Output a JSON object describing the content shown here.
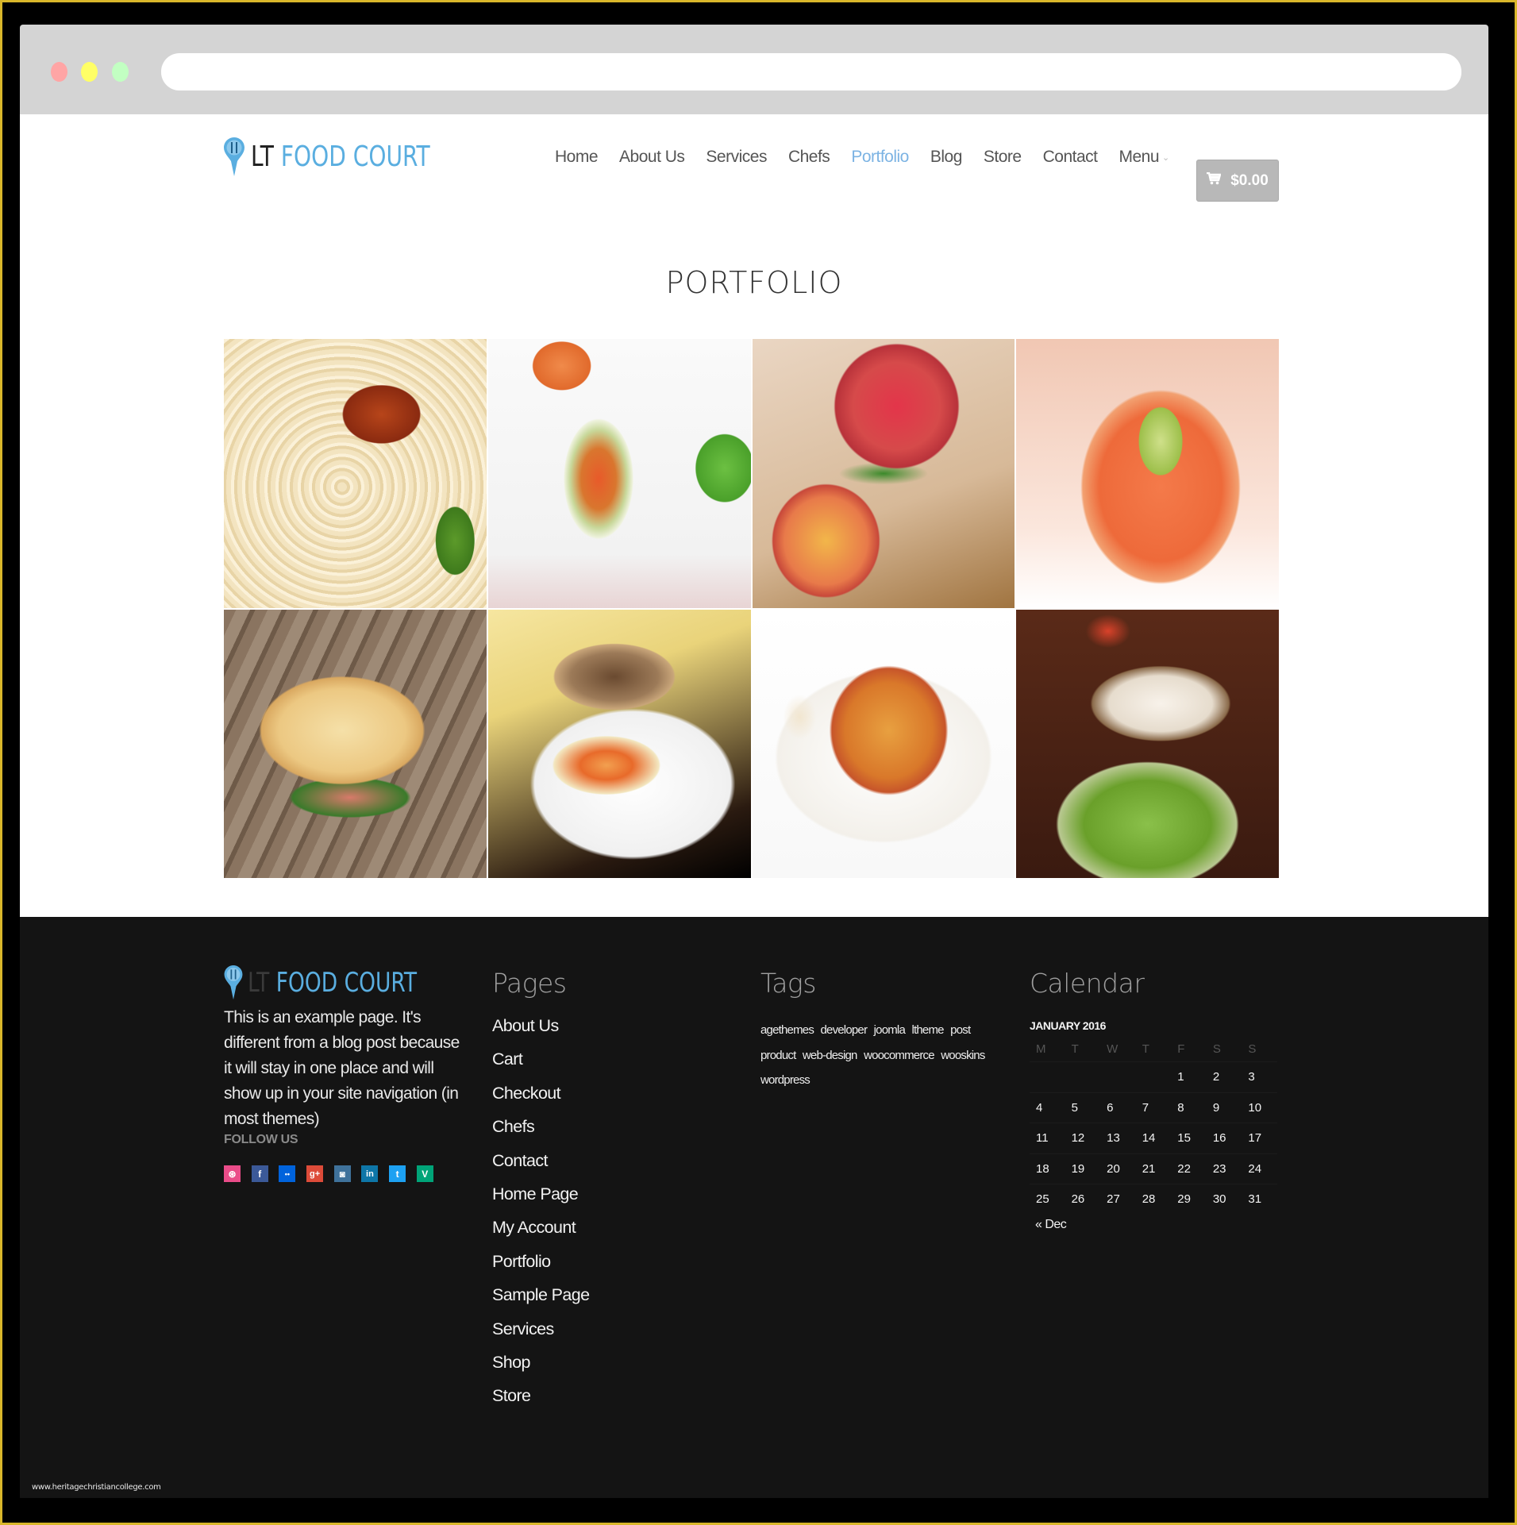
{
  "browser": {
    "address_value": "",
    "window_controls": [
      "close",
      "minimize",
      "maximize"
    ]
  },
  "header": {
    "logo": {
      "prefix": "LT",
      "name": "FOOD COURT",
      "icon": "map-pin-cutlery-icon"
    },
    "nav": [
      {
        "label": "Home",
        "active": false
      },
      {
        "label": "About Us",
        "active": false
      },
      {
        "label": "Services",
        "active": false
      },
      {
        "label": "Chefs",
        "active": false
      },
      {
        "label": "Portfolio",
        "active": true
      },
      {
        "label": "Blog",
        "active": false
      },
      {
        "label": "Store",
        "active": false
      },
      {
        "label": "Contact",
        "active": false
      },
      {
        "label": "Menu",
        "active": false,
        "has_dropdown": true
      }
    ],
    "menu_caret": "⌄",
    "cart": {
      "icon": "cart-icon",
      "total": "$0.00"
    }
  },
  "main": {
    "title": "PORTFOLIO",
    "portfolio_items": [
      {
        "subject": "Spaghetti with tomato sauce"
      },
      {
        "subject": "Spring rolls with mint"
      },
      {
        "subject": "Peaches with leaves in basket"
      },
      {
        "subject": "Smoked salmon with avocado"
      },
      {
        "subject": "Focaccia sandwich"
      },
      {
        "subject": "Grilled chicken with vegetables"
      },
      {
        "subject": "Lasagna with fork"
      },
      {
        "subject": "Fish fillet with salad"
      }
    ]
  },
  "footer": {
    "about": {
      "logo": {
        "prefix": "LT",
        "name": "FOOD COURT"
      },
      "text": "This is an example page. It's different from a blog post because it will stay in one place and will show up in your site navigation (in most themes)",
      "follow_label": "FOLLOW US",
      "socials": [
        {
          "name": "dribbble",
          "glyph": "⊛",
          "color": "#ea4c89"
        },
        {
          "name": "facebook",
          "glyph": "f",
          "color": "#3b5998"
        },
        {
          "name": "flickr",
          "glyph": "••",
          "color": "#0063dc"
        },
        {
          "name": "google-plus",
          "glyph": "g+",
          "color": "#dd4b39"
        },
        {
          "name": "instagram",
          "glyph": "◙",
          "color": "#3f729b"
        },
        {
          "name": "linkedin",
          "glyph": "in",
          "color": "#0e76a8"
        },
        {
          "name": "twitter",
          "glyph": "t",
          "color": "#1da1f2"
        },
        {
          "name": "vine",
          "glyph": "V",
          "color": "#00a478"
        }
      ]
    },
    "pages": {
      "heading": "Pages",
      "items": [
        "About Us",
        "Cart",
        "Checkout",
        "Chefs",
        "Contact",
        "Home Page",
        "My Account",
        "Portfolio",
        "Sample Page",
        "Services",
        "Shop",
        "Store"
      ]
    },
    "tags": {
      "heading": "Tags",
      "items": [
        "agethemes",
        "developer",
        "joomla",
        "ltheme",
        "post",
        "product",
        "web-design",
        "woocommerce",
        "wooskins",
        "wordpress"
      ]
    },
    "calendar": {
      "heading": "Calendar",
      "caption": "JANUARY 2016",
      "weekdays": [
        "M",
        "T",
        "W",
        "T",
        "F",
        "S",
        "S"
      ],
      "weeks": [
        [
          "",
          "",
          "",
          "",
          "1",
          "2",
          "3"
        ],
        [
          "4",
          "5",
          "6",
          "7",
          "8",
          "9",
          "10"
        ],
        [
          "11",
          "12",
          "13",
          "14",
          "15",
          "16",
          "17"
        ],
        [
          "18",
          "19",
          "20",
          "21",
          "22",
          "23",
          "24"
        ],
        [
          "25",
          "26",
          "27",
          "28",
          "29",
          "30",
          "31"
        ]
      ],
      "prev_link": "« Dec"
    }
  },
  "watermark": "www.heritagechristiancollege.com",
  "colors": {
    "brand_blue": "#5aaee0",
    "nav_active": "#7cb3e3",
    "cart_bg": "#b8b8b8",
    "footer_bg": "#141414",
    "frame_border": "#d9b72b"
  }
}
